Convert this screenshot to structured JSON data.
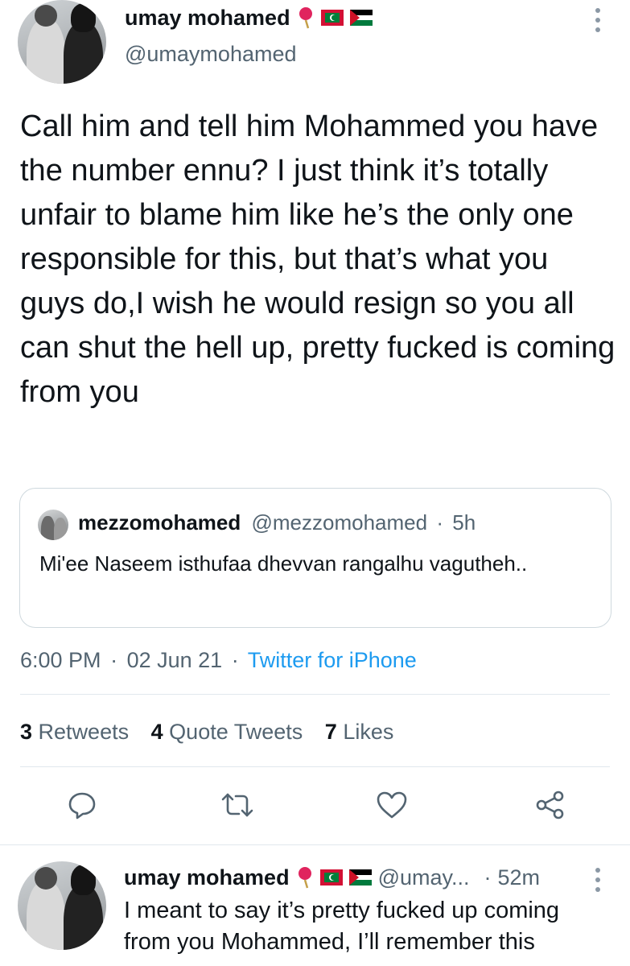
{
  "tweet": {
    "author_name": "umay mohamed",
    "author_handle": "@umaymohamed",
    "text": "Call him and tell him Mohammed you have the number ennu? I just think it’s totally unfair to blame him like he’s the only one responsible for this, but that’s what you guys do,I wish he would resign so you all can shut the hell up, pretty fucked is coming from you",
    "time": "6:00 PM",
    "sep1": "·",
    "date": "02 Jun 21",
    "sep2": "·",
    "source": "Twitter for iPhone"
  },
  "quoted": {
    "name": "mezzomohamed",
    "handle": "@mezzomohamed",
    "sep": "·",
    "age": "5h",
    "text": "Mi'ee Naseem isthufaa dhevvan rangalhu vagutheh.."
  },
  "stats": {
    "retweets_count": "3",
    "retweets_label": "Retweets",
    "quotes_count": "4",
    "quotes_label": "Quote Tweets",
    "likes_count": "7",
    "likes_label": "Likes"
  },
  "actions": [
    "reply-icon",
    "retweet-icon",
    "like-icon",
    "share-icon"
  ],
  "reply": {
    "name": "umay mohamed",
    "handle": "@umay...",
    "sep": "·",
    "age": "52m",
    "text": "I meant to say it’s pretty fucked up coming from you Mohammed, I’ll remember this"
  },
  "colors": {
    "text": "#0f1419",
    "secondary": "#536471",
    "link": "#1d9bf0",
    "pin_red": "#e0245e"
  }
}
